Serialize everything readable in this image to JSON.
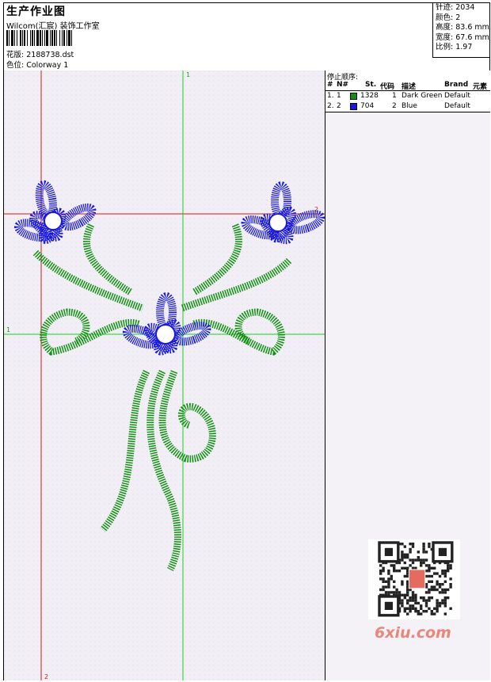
{
  "header": {
    "title": "生产作业图",
    "studio": "Wilcom(汇宸) 装饰工作室",
    "design_label": "花版:",
    "design_file": "2188738.dst",
    "colorway_label": "色位:",
    "colorway": "Colorway 1"
  },
  "stats": {
    "stitches_label": "针迹:",
    "stitches": "2034",
    "colors_label": "颜色:",
    "colors": "2",
    "height_label": "高度:",
    "height": "83.6 mm",
    "width_label": "宽度:",
    "width": "67.6 mm",
    "scale_label": "比例:",
    "scale": "1.97"
  },
  "stop_sequence": {
    "title": "停止顺序:",
    "columns": [
      "#",
      "N#",
      "St.",
      "代码",
      "描述",
      "Brand",
      "元素"
    ],
    "rows": [
      {
        "idx": "1.",
        "n": "1",
        "color": "#109010",
        "stitches": "1328",
        "code": "1",
        "desc": "Dark Green",
        "brand": "Default"
      },
      {
        "idx": "2.",
        "n": "2",
        "color": "#1818e0",
        "stitches": "704",
        "code": "2",
        "desc": "Blue",
        "brand": "Default"
      }
    ]
  },
  "guides": {
    "vertical_1": "1",
    "vertical_2": "2",
    "horizontal_1": "1",
    "horizontal_2": "2"
  },
  "watermark": {
    "brand": "6xiu.com"
  },
  "colors": {
    "green": "#109010",
    "blue": "#1818e0",
    "red_guide": "#d01818",
    "green_guide": "#18d018"
  }
}
